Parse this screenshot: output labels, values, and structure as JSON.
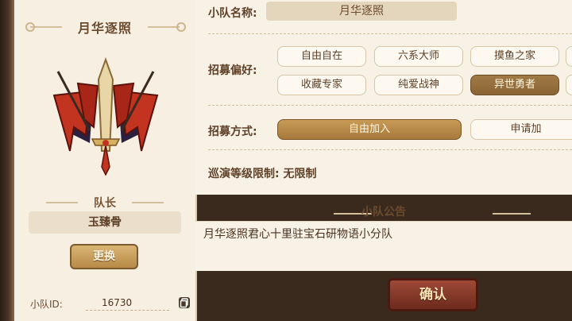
{
  "team_name_label": "小队名称:",
  "team_name_value": "月华逐照",
  "preference_label": "招募偏好:",
  "preferences": [
    {
      "label": "自由自在",
      "selected": false
    },
    {
      "label": "六系大师",
      "selected": false
    },
    {
      "label": "摸鱼之家",
      "selected": false
    },
    {
      "label": "收藏专家",
      "selected": false
    },
    {
      "label": "纯爱战神",
      "selected": false
    },
    {
      "label": "异世勇者",
      "selected": true
    }
  ],
  "method_label": "招募方式:",
  "methods": [
    {
      "label": "自由加入",
      "selected": true
    },
    {
      "label": "申请加",
      "selected": false
    }
  ],
  "level_limit_text": "巡演等级限制: 无限制",
  "left": {
    "team_title": "月华逐照",
    "role": "队长",
    "leader_name": "玉臻骨",
    "change_button": "更换",
    "id_label": "小队ID:",
    "id_value": "16730"
  },
  "notice_title": "小队公告",
  "notice_text": "月华逐照君心十里驻宝石研物语小分队",
  "confirm_button": "确认",
  "colors": {
    "accent_gold": "#b88a46",
    "confirm_red": "#7d3022",
    "panel_bg": "#f8f2e6"
  }
}
